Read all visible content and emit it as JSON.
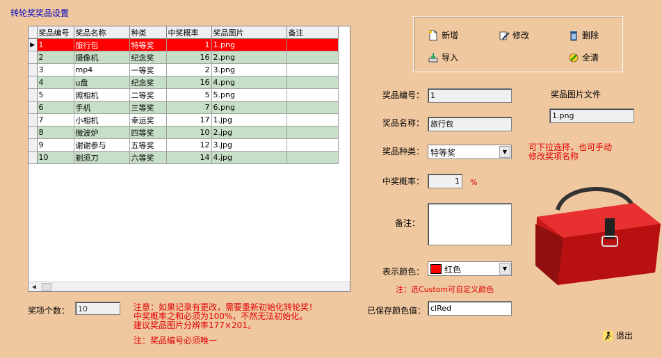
{
  "window": {
    "title": "转轮奖奖品设置"
  },
  "grid": {
    "columns": [
      "奖品编号",
      "奖品名称",
      "种类",
      "中奖概率",
      "奖品图片",
      "备注"
    ],
    "rows": [
      {
        "id": "1",
        "name": "旅行包",
        "type": "特等奖",
        "prob": "1",
        "img": "1.png",
        "note": ""
      },
      {
        "id": "2",
        "name": "摄像机",
        "type": "纪念奖",
        "prob": "16",
        "img": "2.png",
        "note": ""
      },
      {
        "id": "3",
        "name": "mp4",
        "type": "一等奖",
        "prob": "2",
        "img": "3.png",
        "note": ""
      },
      {
        "id": "4",
        "name": "u盘",
        "type": "纪念奖",
        "prob": "16",
        "img": "4.png",
        "note": ""
      },
      {
        "id": "5",
        "name": "照相机",
        "type": "二等奖",
        "prob": "5",
        "img": "5.png",
        "note": ""
      },
      {
        "id": "6",
        "name": "手机",
        "type": "三等奖",
        "prob": "7",
        "img": "6.png",
        "note": ""
      },
      {
        "id": "7",
        "name": "小相机",
        "type": "幸运奖",
        "prob": "17",
        "img": "1.jpg",
        "note": ""
      },
      {
        "id": "8",
        "name": "微波炉",
        "type": "四等奖",
        "prob": "10",
        "img": "2.jpg",
        "note": ""
      },
      {
        "id": "9",
        "name": "谢谢参与",
        "type": "五等奖",
        "prob": "12",
        "img": "3.jpg",
        "note": ""
      },
      {
        "id": "10",
        "name": "剃须刀",
        "type": "六等奖",
        "prob": "14",
        "img": "4.jpg",
        "note": ""
      }
    ],
    "selected_indicator": "▶"
  },
  "toolbar": {
    "add": "新增",
    "edit": "修改",
    "delete": "删除",
    "import": "导入",
    "clear": "全清"
  },
  "form": {
    "id_label": "奖品编号：",
    "id_value": "1",
    "name_label": "奖品名称：",
    "name_value": "旅行包",
    "type_label": "奖品种类：",
    "type_value": "特等奖",
    "prob_label": "中奖概率：",
    "prob_value": "1",
    "prob_unit": "%",
    "note_label": "备注：",
    "note_value": "",
    "color_label": "表示颜色：",
    "color_value": "红色",
    "color_swatch": "#ff0000",
    "saved_color_label": "已保存颜色值：",
    "saved_color_value": "clRed",
    "image_file_label": "奖品图片文件",
    "image_file_value": "1.png"
  },
  "hints": {
    "type_hint_1": "可下拉选择，也可手动",
    "type_hint_2": "修改奖项名称",
    "color_hint": "注：选Custom可自定义颜色",
    "warn_1": "注意：如果记录有更改，需要重新初始化转轮奖！",
    "warn_2": "中奖概率之和必须为100%，不然无法初始化。",
    "warn_3": "建议奖品图片分辨率177×201。",
    "warn_4": "注：奖品编号必须唯一"
  },
  "count": {
    "label": "奖项个数：",
    "value": "10"
  },
  "exit": {
    "label": "退出"
  },
  "colors": {
    "background": "#f0c8a0",
    "selected_row": "#ff0000",
    "alt_row": "#c6dfc6",
    "title": "#0000c0",
    "hint": "#e00000"
  }
}
